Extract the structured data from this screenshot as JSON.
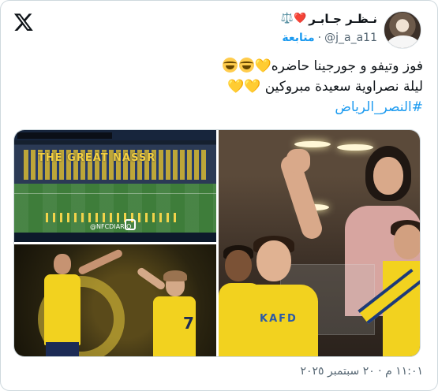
{
  "author": {
    "display_name": "نـظـر جـابـر",
    "name_emojis": "❤️⚖️",
    "handle": "@j_a_a11",
    "separator": "·",
    "follow_label": "متابعة"
  },
  "tweet": {
    "line1_text": "فوز وتيفو و جورجينا حاضره",
    "line1_emojis_after": "💛",
    "line2_text": "ليلة نصراوية سعيدة مبروكين",
    "line2_emojis_after": "💛💛",
    "hashtag": "#النصر_الرياض"
  },
  "media": {
    "image1": {
      "description_icon": "stadium-photo",
      "tifo_text": "THE GREAT NASSR",
      "watermark": "@NFCDIARIO"
    },
    "image2": {
      "description_icon": "players-celebrating-photo",
      "jersey_number": "7"
    },
    "image3": {
      "description_icon": "family-in-box-photo",
      "shirt_text": "KAFD"
    }
  },
  "timestamp": "١١:٠١ م · ٢٠ سبتمبر ٢٠٢٥",
  "colors": {
    "link_blue": "#1d9bf0",
    "secondary_text": "#536471",
    "border": "#cfd9de"
  }
}
